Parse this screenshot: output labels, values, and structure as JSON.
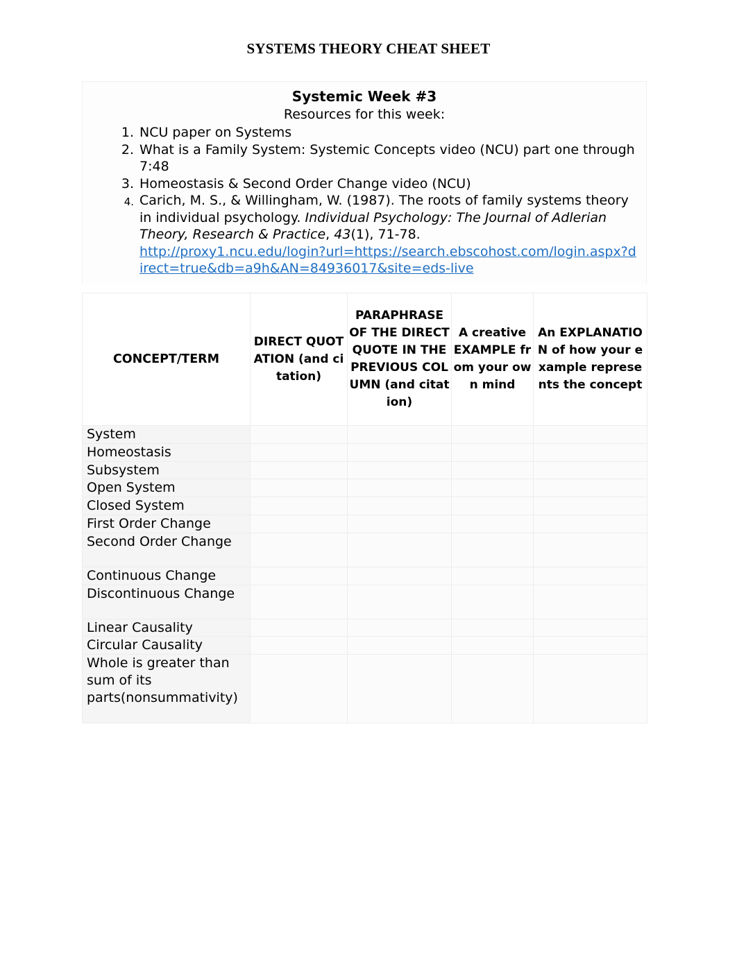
{
  "document": {
    "title": "SYSTEMS THEORY CHEAT SHEET"
  },
  "resources": {
    "heading": "Systemic Week #3",
    "subheading": "Resources for this week:",
    "items": [
      {
        "num": "1.",
        "text": "NCU paper on Systems"
      },
      {
        "num": "2.",
        "text": "What is a Family System: Systemic Concepts video (NCU) part one through 7:48"
      },
      {
        "num": "3.",
        "text": "Homeostasis & Second Order Change video (NCU)"
      },
      {
        "num": "4.",
        "text_part1": "Carich, M. S., & Willingham, W. (1987). The roots of family systems theory in individual psychology. ",
        "italic_part": "Individual Psychology: The Journal of Adlerian Theory, Research & Practice",
        "text_part2": ", ",
        "italic_volume": "43",
        "text_part3": "(1), 71-78.",
        "link": "http://proxy1.ncu.edu/login?url=https://search.ebscohost.com/login.aspx?direct=true&db=a9h&AN=84936017&site=eds-live"
      }
    ]
  },
  "table": {
    "headers": [
      "CONCEPT/TERM",
      "DIRECT QUOTATION (and citation)",
      "PARAPHRASE OF THE DIRECT QUOTE IN THE PREVIOUS COLUMN (and citation)",
      "A creative EXAMPLE from your own mind",
      "An EXPLANATION of how your example represents the concept"
    ],
    "rows": [
      {
        "term": "System",
        "quote": "",
        "paraphrase": "",
        "example": "",
        "explanation": ""
      },
      {
        "term": "Homeostasis",
        "quote": "",
        "paraphrase": "",
        "example": "",
        "explanation": ""
      },
      {
        "term": "Subsystem",
        "quote": "",
        "paraphrase": "",
        "example": "",
        "explanation": ""
      },
      {
        "term": "Open System",
        "quote": "",
        "paraphrase": "",
        "example": "",
        "explanation": ""
      },
      {
        "term": "Closed System",
        "quote": "",
        "paraphrase": "",
        "example": "",
        "explanation": ""
      },
      {
        "term": "First Order Change",
        "quote": "",
        "paraphrase": "",
        "example": "",
        "explanation": ""
      },
      {
        "term": "Second Order Change",
        "quote": "",
        "paraphrase": "",
        "example": "",
        "explanation": ""
      },
      {
        "term": "Continuous Change",
        "quote": "",
        "paraphrase": "",
        "example": "",
        "explanation": ""
      },
      {
        "term": "Discontinuous Change",
        "quote": "",
        "paraphrase": "",
        "example": "",
        "explanation": ""
      },
      {
        "term": "Linear Causality",
        "quote": "",
        "paraphrase": "",
        "example": "",
        "explanation": ""
      },
      {
        "term": "Circular Causality",
        "quote": "",
        "paraphrase": "",
        "example": "",
        "explanation": ""
      },
      {
        "term": "Whole is greater than sum of its parts(nonsummativity)",
        "quote": "",
        "paraphrase": "",
        "example": "",
        "explanation": ""
      }
    ]
  },
  "colors": {
    "link": "#1f6fc4",
    "text": "#000000",
    "table_border": "#ededed",
    "row_background": "#f7f7f7"
  }
}
